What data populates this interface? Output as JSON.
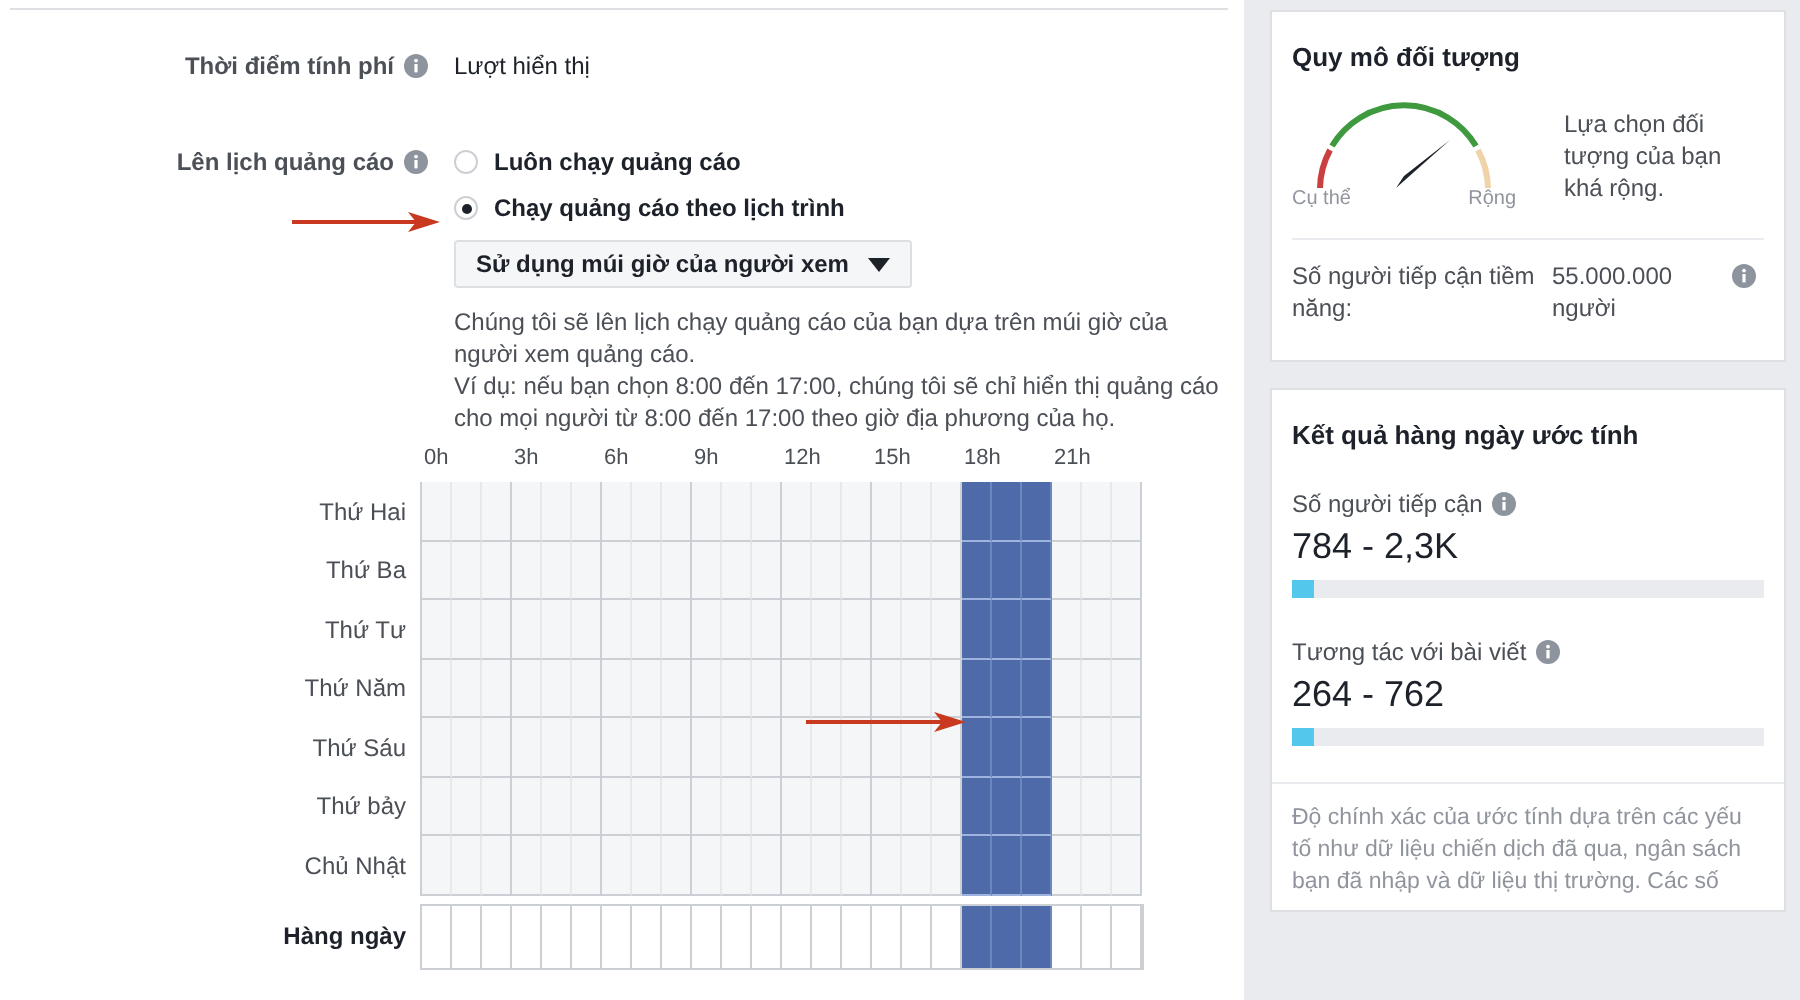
{
  "billing": {
    "label": "Thời điểm tính phí",
    "value": "Lượt hiển thị"
  },
  "schedule": {
    "label": "Lên lịch quảng cáo",
    "options": [
      {
        "label": "Luôn chạy quảng cáo",
        "selected": false
      },
      {
        "label": "Chạy quảng cáo theo lịch trình",
        "selected": true
      }
    ],
    "timezone_dropdown": "Sử dụng múi giờ của người xem",
    "description": [
      "Chúng tôi sẽ lên lịch chạy quảng cáo của bạn dựa trên múi giờ của người xem quảng cáo.",
      "Ví dụ: nếu bạn chọn 8:00 đến 17:00, chúng tôi sẽ chỉ hiển thị quảng cáo cho mọi người từ 8:00 đến 17:00 theo giờ địa phương của họ."
    ],
    "hour_labels": [
      "0h",
      "3h",
      "6h",
      "9h",
      "12h",
      "15h",
      "18h",
      "21h"
    ],
    "days": [
      {
        "label": "Thứ Hai",
        "kind": "day",
        "slots": [
          false,
          false,
          false,
          false,
          false,
          false,
          false,
          false,
          false,
          false,
          false,
          false,
          false,
          false,
          false,
          false,
          false,
          false,
          true,
          true,
          true,
          false,
          false,
          false
        ]
      },
      {
        "label": "Thứ Ba",
        "kind": "day",
        "slots": [
          false,
          false,
          false,
          false,
          false,
          false,
          false,
          false,
          false,
          false,
          false,
          false,
          false,
          false,
          false,
          false,
          false,
          false,
          true,
          true,
          true,
          false,
          false,
          false
        ]
      },
      {
        "label": "Thứ Tư",
        "kind": "day",
        "slots": [
          false,
          false,
          false,
          false,
          false,
          false,
          false,
          false,
          false,
          false,
          false,
          false,
          false,
          false,
          false,
          false,
          false,
          false,
          true,
          true,
          true,
          false,
          false,
          false
        ]
      },
      {
        "label": "Thứ Năm",
        "kind": "day",
        "slots": [
          false,
          false,
          false,
          false,
          false,
          false,
          false,
          false,
          false,
          false,
          false,
          false,
          false,
          false,
          false,
          false,
          false,
          false,
          true,
          true,
          true,
          false,
          false,
          false
        ]
      },
      {
        "label": "Thứ Sáu",
        "kind": "day",
        "slots": [
          false,
          false,
          false,
          false,
          false,
          false,
          false,
          false,
          false,
          false,
          false,
          false,
          false,
          false,
          false,
          false,
          false,
          false,
          true,
          true,
          true,
          false,
          false,
          false
        ]
      },
      {
        "label": "Thứ bảy",
        "kind": "day",
        "slots": [
          false,
          false,
          false,
          false,
          false,
          false,
          false,
          false,
          false,
          false,
          false,
          false,
          false,
          false,
          false,
          false,
          false,
          false,
          true,
          true,
          true,
          false,
          false,
          false
        ]
      },
      {
        "label": "Chủ Nhật",
        "kind": "day",
        "slots": [
          false,
          false,
          false,
          false,
          false,
          false,
          false,
          false,
          false,
          false,
          false,
          false,
          false,
          false,
          false,
          false,
          false,
          false,
          true,
          true,
          true,
          false,
          false,
          false
        ]
      },
      {
        "label": "Hàng ngày",
        "kind": "daily",
        "slots": [
          false,
          false,
          false,
          false,
          false,
          false,
          false,
          false,
          false,
          false,
          false,
          false,
          false,
          false,
          false,
          false,
          false,
          false,
          true,
          true,
          true,
          false,
          false,
          false
        ]
      }
    ]
  },
  "audience": {
    "title": "Quy mô đối tượng",
    "gauge_low": "Cụ thể",
    "gauge_high": "Rộng",
    "summary": "Lựa chọn đối tượng của bạn khá rộng.",
    "reach_label": "Số người tiếp cận tiềm năng:",
    "reach_value": "55.000.000 người"
  },
  "daily_results": {
    "title": "Kết quả hàng ngày ước tính",
    "metrics": [
      {
        "label": "Số người tiếp cận",
        "value": "784 - 2,3K",
        "level": 0.045
      },
      {
        "label": "Tương tác với bài viết",
        "value": "264 - 762",
        "level": 0.045
      }
    ],
    "note": "Độ chính xác của ước tính dựa trên các yếu tố như dữ liệu chiến dịch đã qua, ngân sách bạn đã nhập và dữ liệu thị trường. Các số"
  }
}
